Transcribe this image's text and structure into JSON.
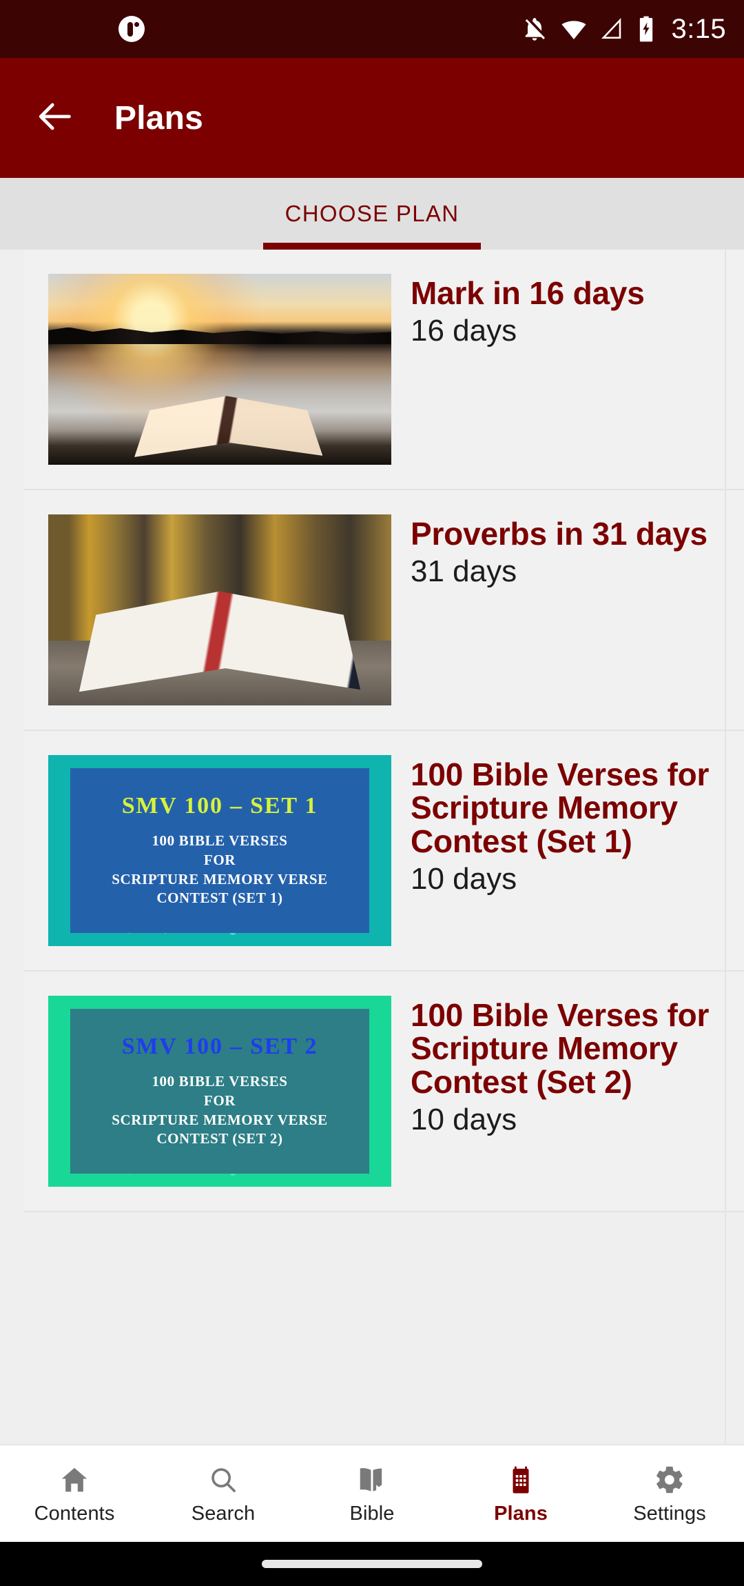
{
  "status_bar": {
    "time": "3:15",
    "icons": [
      "notification-dot-icon",
      "notification-off-icon",
      "wifi-icon",
      "cell-signal-icon",
      "battery-charging-icon"
    ],
    "background": "#3d0404"
  },
  "app_bar": {
    "title": "Plans",
    "back_icon": "arrow-left-icon",
    "background": "#7c0000"
  },
  "tabs": [
    {
      "label": "CHOOSE PLAN",
      "active": true
    }
  ],
  "plans": [
    {
      "title": "Mark in 16 days",
      "days": "16 days",
      "thumb": "sunset-lake-bible-photo"
    },
    {
      "title": "Proverbs in 31 days",
      "days": "31 days",
      "thumb": "open-bible-autumn-photo"
    },
    {
      "title": "100 Bible Verses for Scripture Memory Contest (Set 1)",
      "days": "10 days",
      "thumb": "smv-set1-poster",
      "poster": {
        "heading": "SMV 100 – SET 1",
        "lines": [
          "100 BIBLE VERSES",
          "FOR",
          "SCRIPTURE MEMORY VERSE",
          "CONTEST (SET 1)"
        ],
        "border_color": "#0fb4ae",
        "fill_color": "#2461ab",
        "heading_color": "#d7f23a"
      }
    },
    {
      "title": "100 Bible Verses for Scripture Memory Contest (Set 2)",
      "days": "10 days",
      "thumb": "smv-set2-poster",
      "poster": {
        "heading": "SMV 100 – SET 2",
        "lines": [
          "100 BIBLE VERSES",
          "FOR",
          "SCRIPTURE MEMORY VERSE",
          "CONTEST (SET 2)"
        ],
        "border_color": "#19d796",
        "fill_color": "#2d7e86",
        "heading_color": "#1f3cf0"
      }
    }
  ],
  "bottom_nav": [
    {
      "label": "Contents",
      "icon": "home-icon",
      "active": false
    },
    {
      "label": "Search",
      "icon": "search-icon",
      "active": false
    },
    {
      "label": "Bible",
      "icon": "open-book-icon",
      "active": false
    },
    {
      "label": "Plans",
      "icon": "calendar-icon",
      "active": true
    },
    {
      "label": "Settings",
      "icon": "gear-icon",
      "active": false
    }
  ],
  "colors": {
    "brand": "#7c0000",
    "status_bar": "#3d0404",
    "tab_bar": "#e0e0e0",
    "list_bg": "#efefef",
    "card_bg": "#f1f1f1"
  }
}
